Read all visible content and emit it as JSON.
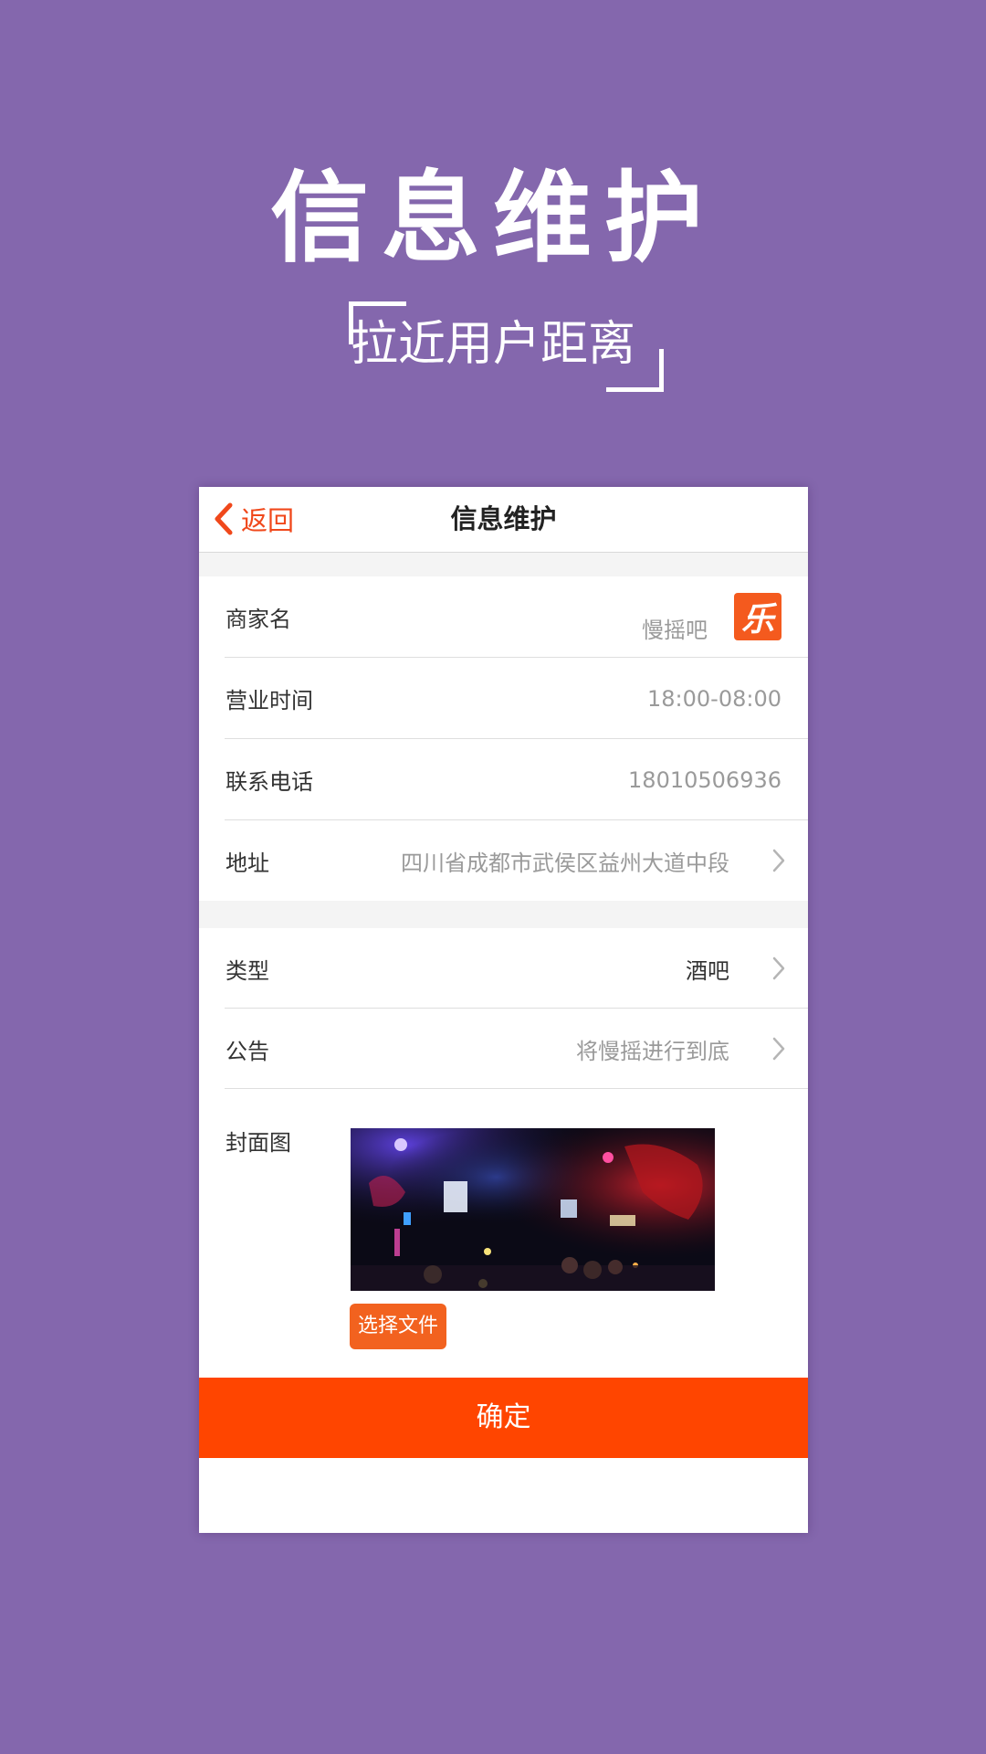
{
  "hero": {
    "title": "信息维护",
    "subtitle": "拉近用户距离"
  },
  "navbar": {
    "back_label": "返回",
    "title": "信息维护"
  },
  "form": {
    "merchant_name": {
      "label": "商家名",
      "value": "慢摇吧",
      "logo_text": "乐"
    },
    "business_hours": {
      "label": "营业时间",
      "value": "18:00-08:00"
    },
    "phone": {
      "label": "联系电话",
      "value": "18010506936"
    },
    "address": {
      "label": "地址",
      "value": "四川省成都市武侯区益州大道中段"
    },
    "type": {
      "label": "类型",
      "value": "酒吧"
    },
    "notice": {
      "label": "公告",
      "value": "将慢摇进行到底"
    },
    "cover": {
      "label": "封面图",
      "choose_file_label": "选择文件"
    }
  },
  "confirm_label": "确定",
  "colors": {
    "background": "#8467ad",
    "accent": "#ff4500",
    "back_text": "#f0481b",
    "logo_bg": "#f45a1e",
    "placeholder_text": "#9a9a9a"
  }
}
